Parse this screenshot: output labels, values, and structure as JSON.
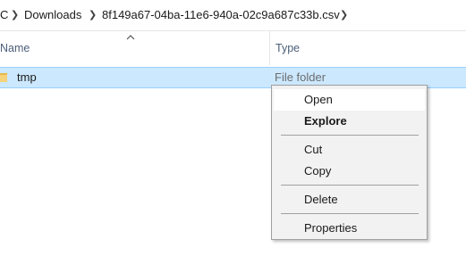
{
  "breadcrumb": {
    "items": [
      "C",
      "Downloads",
      "8f149a67-04ba-11e6-940a-02c9a687c33b.csv"
    ],
    "separator_icon": "chevron-right-icon"
  },
  "columns": {
    "name_label": "Name",
    "type_label": "Type",
    "sort_icon": "sort-ascending-icon"
  },
  "files": [
    {
      "name": "tmp",
      "type": "File folder",
      "icon": "folder-icon",
      "selected": true
    }
  ],
  "context_menu": {
    "items": [
      {
        "label": "Open",
        "bold": false,
        "highlighted": true
      },
      {
        "label": "Explore",
        "bold": true,
        "highlighted": false
      },
      {
        "label": "Cut",
        "bold": false,
        "highlighted": false
      },
      {
        "label": "Copy",
        "bold": false,
        "highlighted": false
      },
      {
        "label": "Delete",
        "bold": false,
        "highlighted": false
      },
      {
        "label": "Properties",
        "bold": false,
        "highlighted": false
      }
    ]
  },
  "colors": {
    "selection_bg": "#cce8ff",
    "selection_border": "#99d1ff",
    "menu_bg": "#f2f2f2",
    "header_text": "#4c607a"
  }
}
